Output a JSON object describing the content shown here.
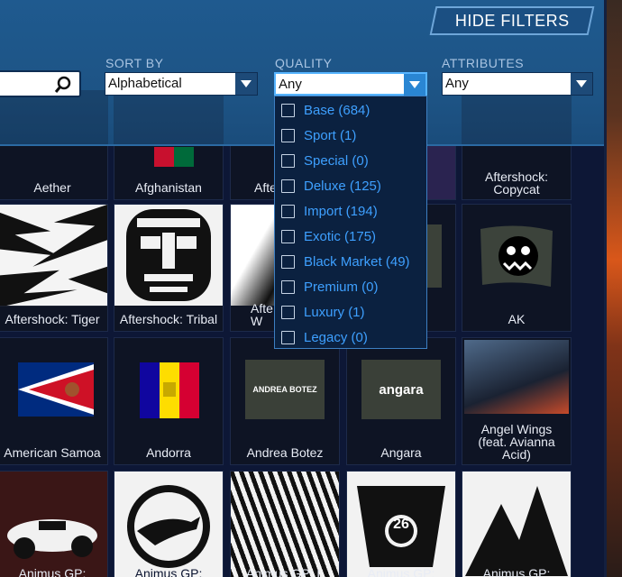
{
  "header": {
    "hide_filters_label": "HIDE FILTERS",
    "search": {
      "value": ""
    },
    "sort_by": {
      "label": "SORT BY",
      "value": "Alphabetical"
    },
    "quality": {
      "label": "QUALITY",
      "value": "Any"
    },
    "attributes": {
      "label": "ATTRIBUTES",
      "value": "Any"
    }
  },
  "quality_dropdown": {
    "options": [
      {
        "label": "Base (684)",
        "checked": false
      },
      {
        "label": "Sport (1)",
        "checked": false
      },
      {
        "label": "Special (0)",
        "checked": false
      },
      {
        "label": "Deluxe (125)",
        "checked": false
      },
      {
        "label": "Import (194)",
        "checked": false
      },
      {
        "label": "Exotic (175)",
        "checked": false
      },
      {
        "label": "Black Market (49)",
        "checked": false
      },
      {
        "label": "Premium (0)",
        "checked": false
      },
      {
        "label": "Luxury (1)",
        "checked": false
      },
      {
        "label": "Legacy (0)",
        "checked": false
      }
    ]
  },
  "items": {
    "row1": [
      "Aether",
      "Afghanistan",
      "Afte",
      "",
      "Aftershock:\nCopycat"
    ],
    "row2": [
      "Aftershock: Tiger",
      "Aftershock: Tribal",
      "Afte\nW",
      "",
      "AK"
    ],
    "row3": [
      "American Samoa",
      "Andorra",
      "Andrea Botez",
      "Angara",
      "Angel Wings\n(feat. Avianna\nAcid)"
    ],
    "row4": [
      "Animus GP:",
      "Animus GP:",
      "Animus GP: L",
      "Animus GP:",
      "Animus GP:"
    ],
    "flag_texts": {
      "andrea_botez": "ANDREA BOTEZ",
      "angara": "angara",
      "number_26": "26"
    }
  },
  "colors": {
    "panel": "#1f5a8f",
    "accent_blue": "#3ea0ff",
    "tile_bg": "#0e1424",
    "caret_active": "#2a86d3"
  }
}
